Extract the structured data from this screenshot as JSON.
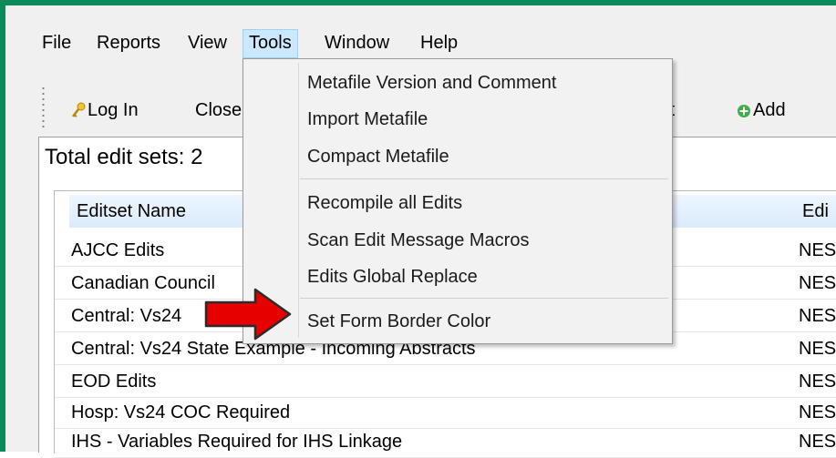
{
  "menubar": {
    "items": [
      "File",
      "Reports",
      "View",
      "Tools",
      "Window",
      "Help"
    ],
    "active": "Tools"
  },
  "toolbar": {
    "login_label": "Log In",
    "close_label": "Close",
    "report_label": "rt",
    "add_label": "Add"
  },
  "content": {
    "total_text": "Total edit sets: 2"
  },
  "table": {
    "columns": [
      "Editset Name",
      "Edi"
    ],
    "rows": [
      [
        "AJCC Edits",
        "NES"
      ],
      [
        "Canadian Council",
        "NES"
      ],
      [
        "Central: Vs24",
        "NES"
      ],
      [
        "Central: Vs24 State Example - Incoming Abstracts",
        "NES"
      ],
      [
        "EOD Edits",
        "NES"
      ],
      [
        "Hosp: Vs24 COC Required",
        "NES"
      ],
      [
        "IHS - Variables Required for IHS Linkage",
        "NES"
      ]
    ]
  },
  "tools_menu": {
    "items": [
      "Metafile Version and Comment",
      "Import Metafile",
      "Compact Metafile",
      "Recompile all Edits",
      "Scan Edit Message Macros",
      "Edits Global Replace",
      "Set Form Border Color"
    ]
  },
  "colors": {
    "window_border": "#0e8a5a",
    "menu_highlight": "#cce8ff",
    "arrow": "#e60000"
  },
  "icons": {
    "login": "key-icon",
    "add": "add-circle-icon",
    "pointer": "red-arrow-icon"
  }
}
